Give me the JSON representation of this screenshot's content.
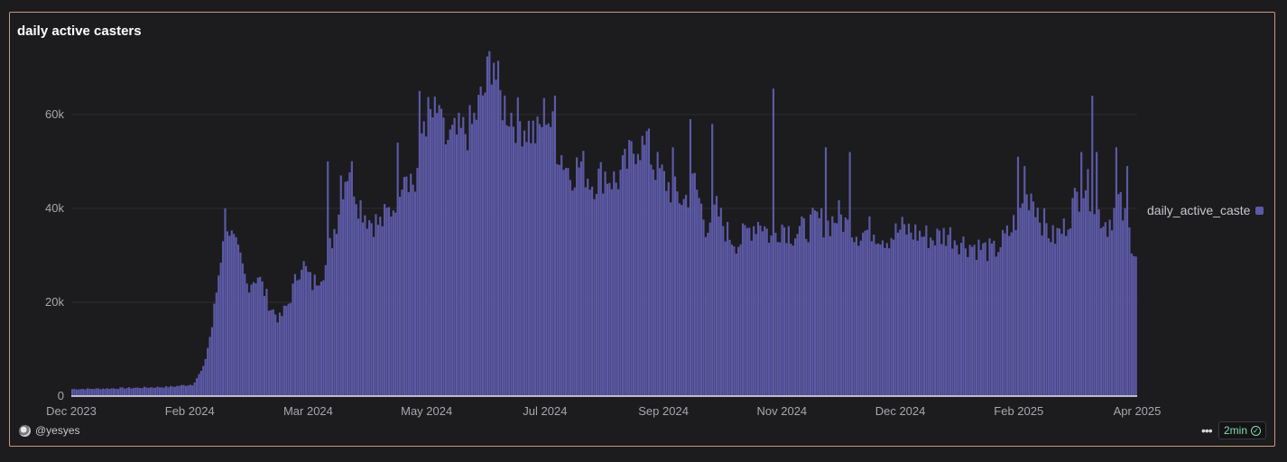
{
  "card": {
    "title": "daily active casters",
    "author": "@yesyes",
    "refresh_label": "2min"
  },
  "colors": {
    "bar": "#5c5aa6",
    "bar_edge": "#8583d6",
    "background": "#1c1b1e",
    "border": "#c99a7d",
    "grid": "#2e2d32",
    "tick_text": "#a8a8ac"
  },
  "icons": {
    "more": "more-horizontal-icon",
    "check": "check-circle-icon",
    "avatar": "avatar-icon"
  },
  "chart_data": {
    "type": "bar",
    "title": "daily active casters",
    "xlabel": "",
    "ylabel": "",
    "ylim": [
      0,
      74000
    ],
    "grid": true,
    "legend_position": "right",
    "x_start": "2023-12-01",
    "x_end": "2025-04-01",
    "x_ticks": [
      "Dec 2023",
      "Feb 2024",
      "Mar 2024",
      "May 2024",
      "Jul 2024",
      "Sep 2024",
      "Nov 2024",
      "Dec 2024",
      "Feb 2025",
      "Apr 2025"
    ],
    "y_ticks": [
      {
        "value": 0,
        "label": "0"
      },
      {
        "value": 20000,
        "label": "20k"
      },
      {
        "value": 40000,
        "label": "40k"
      },
      {
        "value": 60000,
        "label": "60k"
      }
    ],
    "series": [
      {
        "name": "daily_active_caste",
        "anchors": [
          [
            "2023-12-01",
            1500
          ],
          [
            "2023-12-15",
            1600
          ],
          [
            "2024-01-01",
            1800
          ],
          [
            "2024-01-15",
            2000
          ],
          [
            "2024-01-25",
            2500
          ],
          [
            "2024-01-30",
            6000
          ],
          [
            "2024-02-03",
            15000
          ],
          [
            "2024-02-07",
            30000
          ],
          [
            "2024-02-09",
            40000
          ],
          [
            "2024-02-12",
            34000
          ],
          [
            "2024-02-16",
            29000
          ],
          [
            "2024-02-19",
            24000
          ],
          [
            "2024-02-24",
            26000
          ],
          [
            "2024-03-01",
            19000
          ],
          [
            "2024-03-05",
            16500
          ],
          [
            "2024-03-09",
            20000
          ],
          [
            "2024-03-15",
            29000
          ],
          [
            "2024-03-20",
            24000
          ],
          [
            "2024-03-26",
            28000
          ],
          [
            "2024-03-31",
            38000
          ],
          [
            "2024-04-03",
            46000
          ],
          [
            "2024-04-06",
            50000
          ],
          [
            "2024-04-10",
            42000
          ],
          [
            "2024-04-15",
            38000
          ],
          [
            "2024-04-20",
            37000
          ],
          [
            "2024-04-26",
            41000
          ],
          [
            "2024-05-01",
            50000
          ],
          [
            "2024-05-06",
            45000
          ],
          [
            "2024-05-10",
            60000
          ],
          [
            "2024-05-15",
            60000
          ],
          [
            "2024-05-20",
            55000
          ],
          [
            "2024-05-26",
            56000
          ],
          [
            "2024-06-01",
            58000
          ],
          [
            "2024-06-07",
            66000
          ],
          [
            "2024-06-10",
            73000
          ],
          [
            "2024-06-14",
            64000
          ],
          [
            "2024-06-20",
            60000
          ],
          [
            "2024-06-26",
            58000
          ],
          [
            "2024-07-01",
            56000
          ],
          [
            "2024-07-05",
            62000
          ],
          [
            "2024-07-10",
            54000
          ],
          [
            "2024-07-16",
            48000
          ],
          [
            "2024-07-21",
            50000
          ],
          [
            "2024-07-26",
            46000
          ],
          [
            "2024-08-01",
            48000
          ],
          [
            "2024-08-06",
            46000
          ],
          [
            "2024-08-11",
            50000
          ],
          [
            "2024-08-16",
            55000
          ],
          [
            "2024-08-21",
            52000
          ],
          [
            "2024-08-26",
            48000
          ],
          [
            "2024-09-01",
            44000
          ],
          [
            "2024-09-06",
            42000
          ],
          [
            "2024-09-11",
            46000
          ],
          [
            "2024-09-16",
            37000
          ],
          [
            "2024-09-21",
            40000
          ],
          [
            "2024-09-26",
            35000
          ],
          [
            "2024-10-01",
            33000
          ],
          [
            "2024-10-06",
            36000
          ],
          [
            "2024-10-11",
            38000
          ],
          [
            "2024-10-16",
            34000
          ],
          [
            "2024-10-21",
            37000
          ],
          [
            "2024-10-26",
            35000
          ],
          [
            "2024-11-01",
            36000
          ],
          [
            "2024-11-06",
            38000
          ],
          [
            "2024-11-11",
            37000
          ],
          [
            "2024-11-16",
            39000
          ],
          [
            "2024-11-21",
            36000
          ],
          [
            "2024-11-26",
            35000
          ],
          [
            "2024-12-01",
            36000
          ],
          [
            "2024-12-08",
            34000
          ],
          [
            "2024-12-15",
            36000
          ],
          [
            "2024-12-22",
            35000
          ],
          [
            "2024-12-29",
            34000
          ],
          [
            "2025-01-05",
            35000
          ],
          [
            "2025-01-12",
            33000
          ],
          [
            "2025-01-19",
            32000
          ],
          [
            "2025-01-26",
            31000
          ],
          [
            "2025-02-02",
            35000
          ],
          [
            "2025-02-07",
            40000
          ],
          [
            "2025-02-12",
            44000
          ],
          [
            "2025-02-17",
            38000
          ],
          [
            "2025-02-22",
            34000
          ],
          [
            "2025-02-27",
            36000
          ],
          [
            "2025-03-04",
            42000
          ],
          [
            "2025-03-09",
            46000
          ],
          [
            "2025-03-14",
            40000
          ],
          [
            "2025-03-19",
            37000
          ],
          [
            "2025-03-24",
            42000
          ],
          [
            "2025-03-29",
            35000
          ],
          [
            "2025-04-01",
            31000
          ]
        ],
        "spikes": [
          [
            "2024-06-09",
            73500
          ],
          [
            "2024-06-11",
            71000
          ],
          [
            "2024-05-08",
            65000
          ],
          [
            "2024-05-17",
            62000
          ],
          [
            "2024-07-09",
            64000
          ],
          [
            "2024-10-17",
            65500
          ],
          [
            "2024-09-09",
            59000
          ],
          [
            "2024-09-19",
            58000
          ],
          [
            "2024-03-27",
            50000
          ],
          [
            "2024-04-02",
            47000
          ],
          [
            "2024-04-28",
            54000
          ],
          [
            "2024-11-10",
            53000
          ],
          [
            "2024-11-21",
            52000
          ],
          [
            "2025-02-06",
            51000
          ],
          [
            "2025-02-09",
            49000
          ],
          [
            "2025-03-12",
            64000
          ],
          [
            "2025-03-07",
            52000
          ],
          [
            "2025-03-14",
            52000
          ],
          [
            "2025-03-23",
            53000
          ],
          [
            "2025-03-28",
            49000
          ],
          [
            "2024-08-21",
            57000
          ],
          [
            "2024-09-01",
            53000
          ],
          [
            "2024-02-09",
            40000
          ]
        ]
      }
    ]
  }
}
